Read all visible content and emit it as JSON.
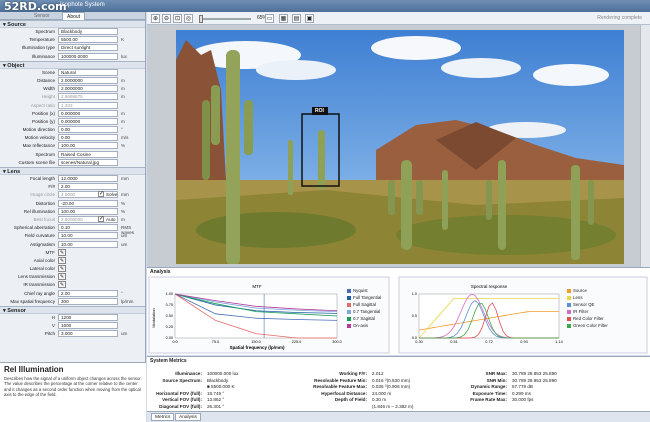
{
  "app": {
    "title": "Isophote System",
    "watermark": "52RD.com"
  },
  "left_tabs": [
    "Sensor",
    "About"
  ],
  "source": {
    "title": "Source",
    "rows": [
      {
        "label": "Spectrum",
        "value": "Blackbody",
        "unit": ""
      },
      {
        "label": "Temperature",
        "value": "5500.00",
        "unit": "K"
      },
      {
        "label": "Illumination type",
        "value": "Direct sunlight",
        "unit": ""
      },
      {
        "label": "Illuminance",
        "value": "100000.0000",
        "unit": "lux"
      }
    ]
  },
  "object": {
    "title": "Object",
    "rows": [
      {
        "label": "Scene",
        "value": "Natural",
        "unit": ""
      },
      {
        "label": "Distance",
        "value": "2.0000000",
        "unit": "m"
      },
      {
        "label": "Width",
        "value": "2.0000000",
        "unit": "m"
      },
      {
        "label": "Height",
        "value": "2.6666675",
        "unit": "m"
      },
      {
        "label": "Aspect ratio",
        "value": "1.333",
        "unit": ""
      },
      {
        "label": "Position (x)",
        "value": "0.000000",
        "unit": "m"
      },
      {
        "label": "Position (y)",
        "value": "0.000000",
        "unit": "m"
      },
      {
        "label": "Motion direction",
        "value": "0.00",
        "unit": "°"
      },
      {
        "label": "Motion velocity",
        "value": "0.00",
        "unit": "m/s"
      },
      {
        "label": "Max reflectance",
        "value": "100.00",
        "unit": "%"
      },
      {
        "label": "Spectrum",
        "value": "Raised Cosine",
        "unit": ""
      },
      {
        "label": "Custom scene file",
        "value": "scenes/Natural.jpg",
        "unit": ""
      }
    ]
  },
  "lens": {
    "title": "Lens",
    "rows": [
      {
        "label": "Focal length",
        "value": "12.0000",
        "unit": "mm"
      },
      {
        "label": "F/#",
        "value": "2.00",
        "unit": ""
      },
      {
        "label": "Image circle",
        "value": "4.5000",
        "unit": "mm",
        "check": "Solve"
      },
      {
        "label": "Distortion",
        "value": "-20.00",
        "unit": "%"
      },
      {
        "label": "Rel illumination",
        "value": "100.00",
        "unit": "%"
      },
      {
        "label": "Best focus",
        "value": "2.5000000",
        "unit": "m",
        "check": "Auto"
      },
      {
        "label": "Spherical aberration",
        "value": "0.10",
        "unit": "RMS waves"
      },
      {
        "label": "Field curvature",
        "value": "10.00",
        "unit": "um"
      },
      {
        "label": "Astigmatism",
        "value": "10.00",
        "unit": "um"
      }
    ],
    "buttons": [
      "MTF",
      "Axial color",
      "Lateral color",
      "Lens transmission",
      "IR transmission"
    ],
    "chief_ray": {
      "label": "Chief ray angle",
      "value": "2.00",
      "unit": "°"
    },
    "max_freq": {
      "label": "Max spatial frequency",
      "value": "300",
      "unit": "lp/mm"
    }
  },
  "sensor": {
    "title": "Sensor",
    "rows": [
      {
        "label": "H",
        "value": "1200",
        "unit": ""
      },
      {
        "label": "V",
        "value": "1600",
        "unit": ""
      },
      {
        "label": "Pitch",
        "value": "3.000",
        "unit": "um"
      }
    ]
  },
  "help": {
    "title": "Rel Illumination",
    "text": "Describes how the signal of a uniform object changes across the sensor. The value describes the percentage at the corner relative to the center and it changes as a second order function when moving from the optical axis to the edge of the field."
  },
  "toolbar": {
    "zoom": "65%",
    "status": "Rendering complete"
  },
  "roi_label": "ROI",
  "analysis": {
    "title": "Analysis",
    "mtf": {
      "title": "MTF",
      "xlabel": "Spatial frequency (lp/mm)",
      "ylabel": "Modulation",
      "xticks": [
        "0.0",
        "75.0",
        "150.0",
        "225.0",
        "300.0"
      ],
      "yticks": [
        "0.00",
        "0.25",
        "0.50",
        "0.75",
        "1.00"
      ],
      "legend": [
        {
          "name": "Nyquist",
          "color": "#4a6fb8"
        },
        {
          "name": "Full Tangential",
          "color": "#1c5fa8"
        },
        {
          "name": "Full Sagittal",
          "color": "#e56a6a"
        },
        {
          "name": "0.7 Tangential",
          "color": "#7fa7d9"
        },
        {
          "name": "0.7 Sagittal",
          "color": "#1a9d5a"
        },
        {
          "name": "On-axis",
          "color": "#b43a9c"
        }
      ]
    },
    "spectral": {
      "title": "Spectral response",
      "xticks": [
        "0.30",
        "0.51",
        "0.72",
        "0.93",
        "1.14"
      ],
      "yticks": [
        "0.0",
        "0.5",
        "1.0"
      ],
      "legend": [
        {
          "name": "Source",
          "color": "#f29b2b"
        },
        {
          "name": "Lens",
          "color": "#e8d84a"
        },
        {
          "name": "Sensor QE",
          "color": "#5a8fd4"
        },
        {
          "name": "IR Filter",
          "color": "#d16ac8"
        },
        {
          "name": "Red Color Filter",
          "color": "#e05050"
        },
        {
          "name": "Green Color Filter",
          "color": "#3fa84a"
        }
      ]
    }
  },
  "metrics": {
    "title": "System Metrics",
    "col1": [
      {
        "k": "Illuminance:",
        "v": "100000.000 lux"
      },
      {
        "k": "Source Spectrum:",
        "v": "Blackbody"
      },
      {
        "k": "",
        "v": "■ 5500.000 K"
      },
      {
        "k": "Horizontal FOV (full):",
        "v": "18.749 °"
      },
      {
        "k": "Vertical FOV (full):",
        "v": "13.862 °"
      },
      {
        "k": "Diagonal FOV (full):",
        "v": "26.301 °"
      }
    ],
    "col2": [
      {
        "k": "Working F/#:",
        "v": "2.012"
      },
      {
        "k": "Resolvable Feature Min:",
        "v": "0.016 ⁰(0.530 mm)"
      },
      {
        "k": "Resolvable Feature Max:",
        "v": "0.035 ⁰(0.906 mm)"
      },
      {
        "k": "Hyperfocal Distance:",
        "v": "24.000 m"
      },
      {
        "k": "Depth of Field:",
        "v": "0.30 m"
      },
      {
        "k": "",
        "v": "(1.846 m – 2.382 m)"
      }
    ],
    "col3": [
      {
        "k": "SNR Max:",
        "v": "30.789  28.853  25.890"
      },
      {
        "k": "SNR Min:",
        "v": "30.789  28.853  25.890"
      },
      {
        "k": "Dynamic Range:",
        "v": "57.778 dB"
      },
      {
        "k": "Exposure Time:",
        "v": "0.299 ms"
      },
      {
        "k": "Frame Rate Max:",
        "v": "30.000 fps"
      }
    ]
  },
  "bottom_tabs": [
    "Metrics",
    "Analysis"
  ]
}
